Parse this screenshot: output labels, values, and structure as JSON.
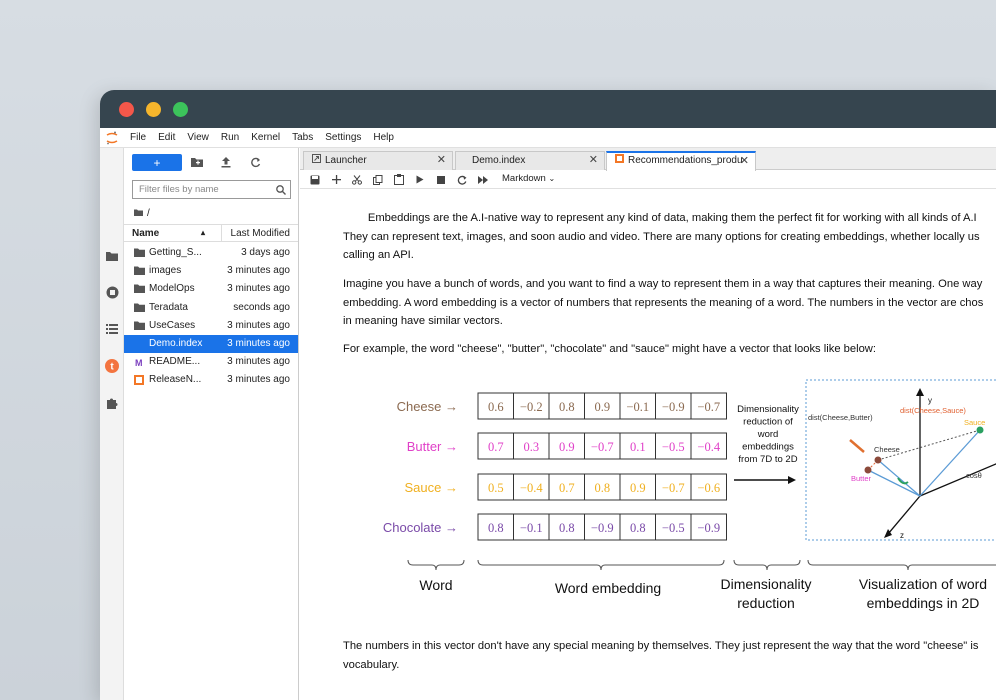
{
  "menubar": {
    "items": [
      "File",
      "Edit",
      "View",
      "Run",
      "Kernel",
      "Tabs",
      "Settings",
      "Help"
    ]
  },
  "filebrowser": {
    "new_label": "+",
    "filter_placeholder": "Filter files by name",
    "breadcrumb": "/",
    "header": {
      "name": "Name",
      "modified": "Last Modified"
    },
    "files": [
      {
        "name": "Getting_S...",
        "modified": "3 days ago",
        "type": "folder"
      },
      {
        "name": "images",
        "modified": "3 minutes ago",
        "type": "folder"
      },
      {
        "name": "ModelOps",
        "modified": "3 minutes ago",
        "type": "folder"
      },
      {
        "name": "Teradata",
        "modified": "seconds ago",
        "type": "folder"
      },
      {
        "name": "UseCases",
        "modified": "3 minutes ago",
        "type": "folder"
      },
      {
        "name": "Demo.index",
        "modified": "3 minutes ago",
        "type": "file",
        "selected": true
      },
      {
        "name": "README...",
        "modified": "3 minutes ago",
        "type": "markdown"
      },
      {
        "name": "ReleaseN...",
        "modified": "3 minutes ago",
        "type": "notebook"
      }
    ]
  },
  "tabs": [
    {
      "label": "Launcher",
      "active": false
    },
    {
      "label": "Demo.index",
      "active": false
    },
    {
      "label": "Recommendations_produ",
      "active": true
    }
  ],
  "notebook_toolbar": {
    "cell_type": "Markdown"
  },
  "content": {
    "p1": [
      "        Embeddings are the A.I-native way to represent any kind of data, making them the perfect fit for working with all kinds of A.I",
      "They can represent text, images, and soon audio and video. There are many options for creating embeddings, whether locally us",
      "calling an API."
    ],
    "p2": [
      "Imagine you have a bunch of words, and you want to find a way to represent them in a way that captures their meaning. One way",
      "embedding. A word embedding is a vector of numbers that represents the meaning of a word. The numbers in the vector are chos",
      "in meaning have similar vectors."
    ],
    "p3": [
      "For example, the word \"cheese\", \"butter\", \"chocolate\" and \"sauce\" might have a vector that looks like below:"
    ],
    "p4": [
      "The numbers in this vector don't have any special meaning by themselves. They just represent the way that the word \"cheese\" is",
      "vocabulary."
    ]
  },
  "figure": {
    "words": [
      {
        "label": "Cheese →",
        "values": [
          "0.6",
          "−0.2",
          "0.8",
          "0.9",
          "−0.1",
          "−0.9",
          "−0.7"
        ],
        "color": "#8b6a50"
      },
      {
        "label": "Butter →",
        "values": [
          "0.7",
          "0.3",
          "0.9",
          "−0.7",
          "0.1",
          "−0.5",
          "−0.4"
        ],
        "color": "#e040c8"
      },
      {
        "label": "Sauce →",
        "values": [
          "0.5",
          "−0.4",
          "0.7",
          "0.8",
          "0.9",
          "−0.7",
          "−0.6"
        ],
        "color": "#f0b020"
      },
      {
        "label": "Chocolate →",
        "values": [
          "0.8",
          "−0.1",
          "0.8",
          "−0.9",
          "0.8",
          "−0.5",
          "−0.9"
        ],
        "color": "#7a4aa8"
      }
    ],
    "reduction_text": [
      "Dimensionality",
      "reduction of",
      "word",
      "embeddings",
      "from 7D to 2D"
    ],
    "plot_labels": {
      "y": "y",
      "z": "z",
      "dist1": "dist(Cheese,Butter)",
      "dist2": "dist(Cheese,Sauce)",
      "cheese": "Cheese",
      "butter": "Butter",
      "sauce": "Sauce",
      "cos": "cosθ"
    },
    "bottom_labels": {
      "word": "Word",
      "embedding": "Word embedding",
      "dim1": "Dimensionality",
      "dim2": "reduction",
      "vis1": "Visualization of word",
      "vis2": "embeddings  in 2D"
    }
  }
}
